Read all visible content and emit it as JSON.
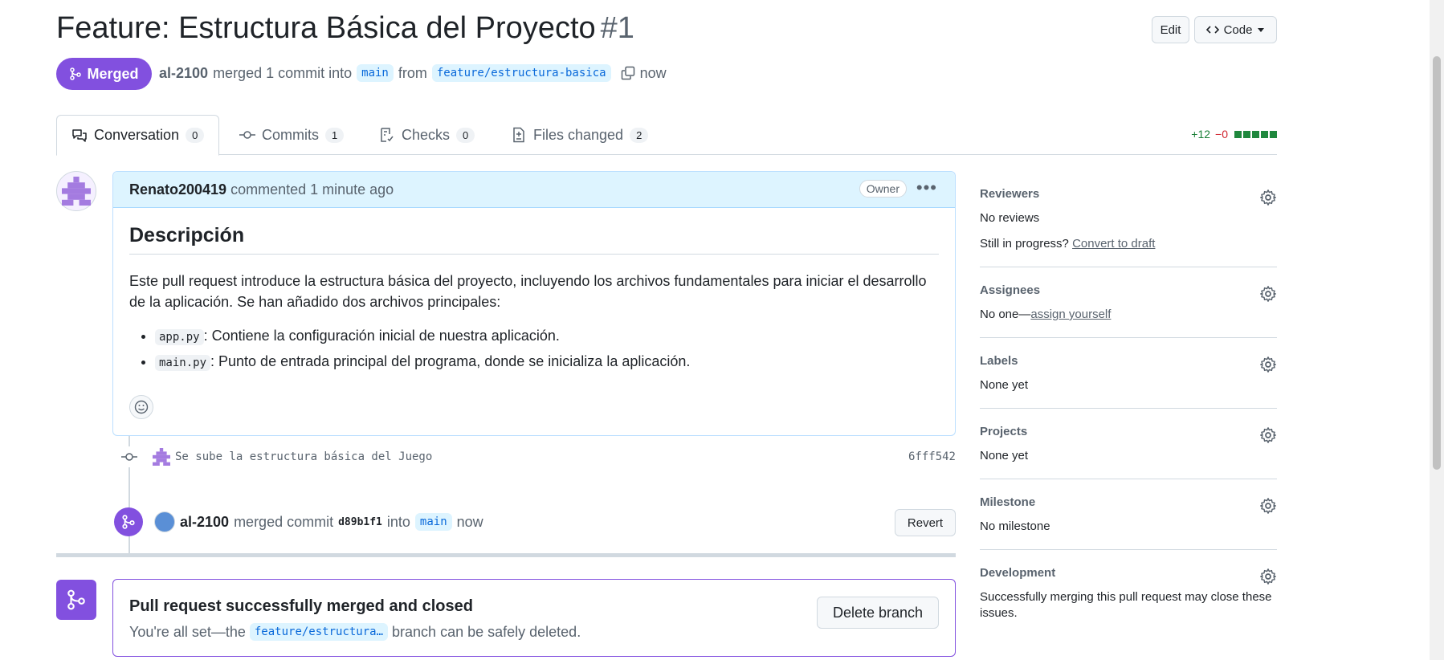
{
  "pr": {
    "title": "Feature: Estructura Básica del Proyecto",
    "number": "#1",
    "status": "Merged",
    "author": "al-2100",
    "merged_text": "merged 1 commit into",
    "base_branch": "main",
    "from_text": "from",
    "head_branch": "feature/estructura-basica",
    "time": "now"
  },
  "header_buttons": {
    "edit": "Edit",
    "code": "Code"
  },
  "tabs": [
    {
      "label": "Conversation",
      "count": "0"
    },
    {
      "label": "Commits",
      "count": "1"
    },
    {
      "label": "Checks",
      "count": "0"
    },
    {
      "label": "Files changed",
      "count": "2"
    }
  ],
  "diffstat": {
    "additions": "+12",
    "deletions": "−0"
  },
  "comment": {
    "user": "Renato200419",
    "action": "commented 1 minute ago",
    "badge": "Owner",
    "heading": "Descripción",
    "paragraph": "Este pull request introduce la estructura básica del proyecto, incluyendo los archivos fundamentales para iniciar el desarrollo de la aplicación. Se han añadido dos archivos principales:",
    "items": [
      {
        "code": "app.py",
        "text": ": Contiene la configuración inicial de nuestra aplicación."
      },
      {
        "code": "main.py",
        "text": ": Punto de entrada principal del programa, donde se inicializa la aplicación."
      }
    ]
  },
  "commit": {
    "message": "Se sube la estructura básica del Juego",
    "sha": "6fff542"
  },
  "merge_event": {
    "user": "al-2100",
    "text": "merged commit",
    "sha": "d89b1f1",
    "into": "into",
    "branch": "main",
    "time": "now",
    "revert": "Revert"
  },
  "merged_box": {
    "title": "Pull request successfully merged and closed",
    "sub_prefix": "You're all set—the",
    "branch": "feature/estructura…",
    "sub_suffix": "branch can be safely deleted.",
    "delete_button": "Delete branch"
  },
  "sidebar": {
    "reviewers": {
      "title": "Reviewers",
      "value": "No reviews",
      "progress": "Still in progress?",
      "draft_link": "Convert to draft"
    },
    "assignees": {
      "title": "Assignees",
      "prefix": "No one—",
      "link": "assign yourself"
    },
    "labels": {
      "title": "Labels",
      "value": "None yet"
    },
    "projects": {
      "title": "Projects",
      "value": "None yet"
    },
    "milestone": {
      "title": "Milestone",
      "value": "No milestone"
    },
    "development": {
      "title": "Development",
      "value": "Successfully merging this pull request may close these issues."
    }
  },
  "colors": {
    "merged": "#8250df",
    "accent": "#0969da",
    "add": "#1a7f37",
    "del": "#d1242f"
  },
  "icons": [
    "git-merge-icon",
    "copy-icon",
    "comment-discussion-icon",
    "git-commit-icon",
    "checklist-icon",
    "file-diff-icon",
    "kebab-horizontal-icon",
    "smiley-icon",
    "gear-icon",
    "triangle-down-icon",
    "code-icon"
  ]
}
